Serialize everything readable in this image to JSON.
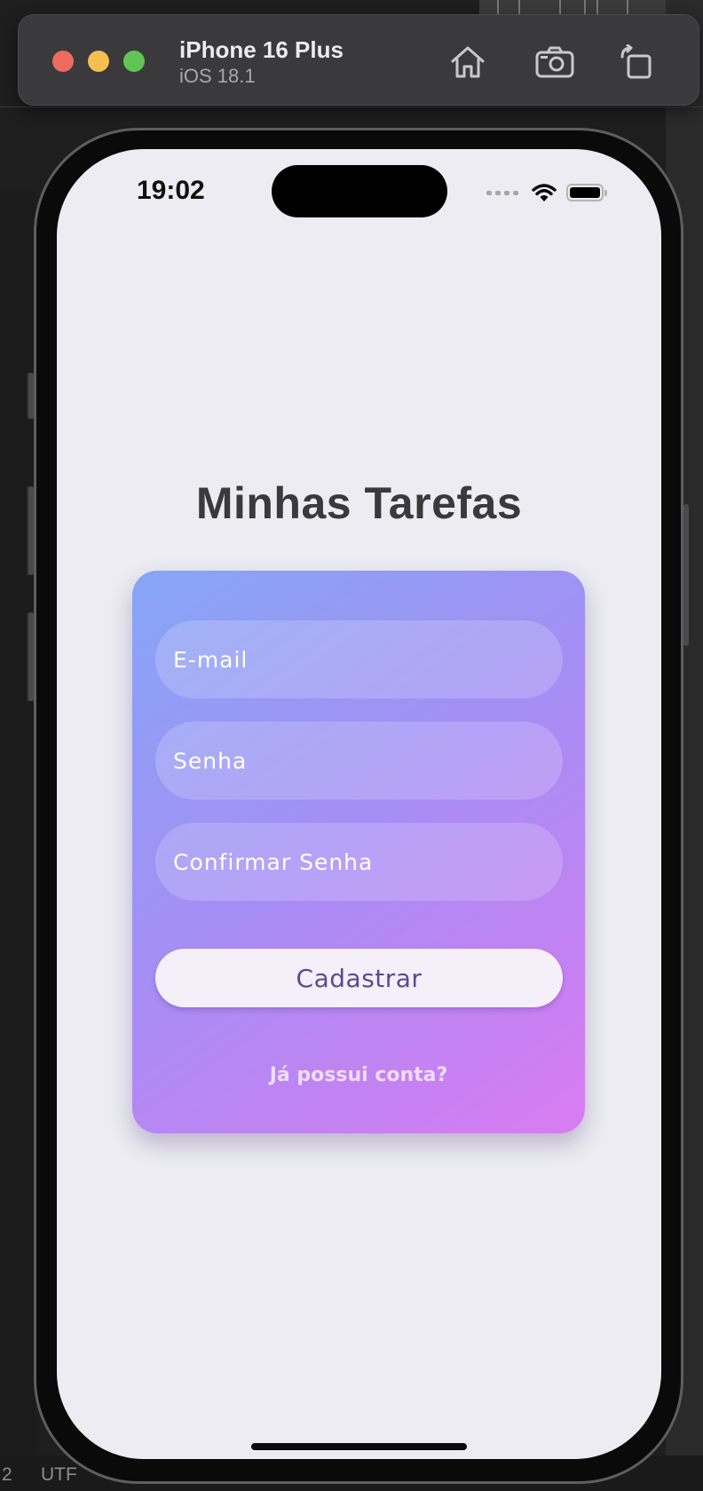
{
  "simulator": {
    "device_name": "iPhone 16 Plus",
    "os_version": "iOS 18.1",
    "buttons": {
      "home": "home-icon",
      "screenshot": "camera-icon",
      "rotate": "rotate-icon"
    }
  },
  "background": {
    "status_left": "2",
    "status_encoding": "UTF"
  },
  "status_bar": {
    "time": "19:02"
  },
  "app": {
    "title": "Minhas Tarefas",
    "email_placeholder": "E-mail",
    "password_placeholder": "Senha",
    "confirm_password_placeholder": "Confirmar Senha",
    "submit_label": "Cadastrar",
    "login_link": "Já possui conta?"
  },
  "colors": {
    "screen_background": "#ececf2",
    "card_gradient_start": "#86a6f6",
    "card_gradient_end": "#d97cf1",
    "button_background": "#f4eff8",
    "button_text": "#5c4a8e",
    "title_text": "#3a3a3c"
  }
}
